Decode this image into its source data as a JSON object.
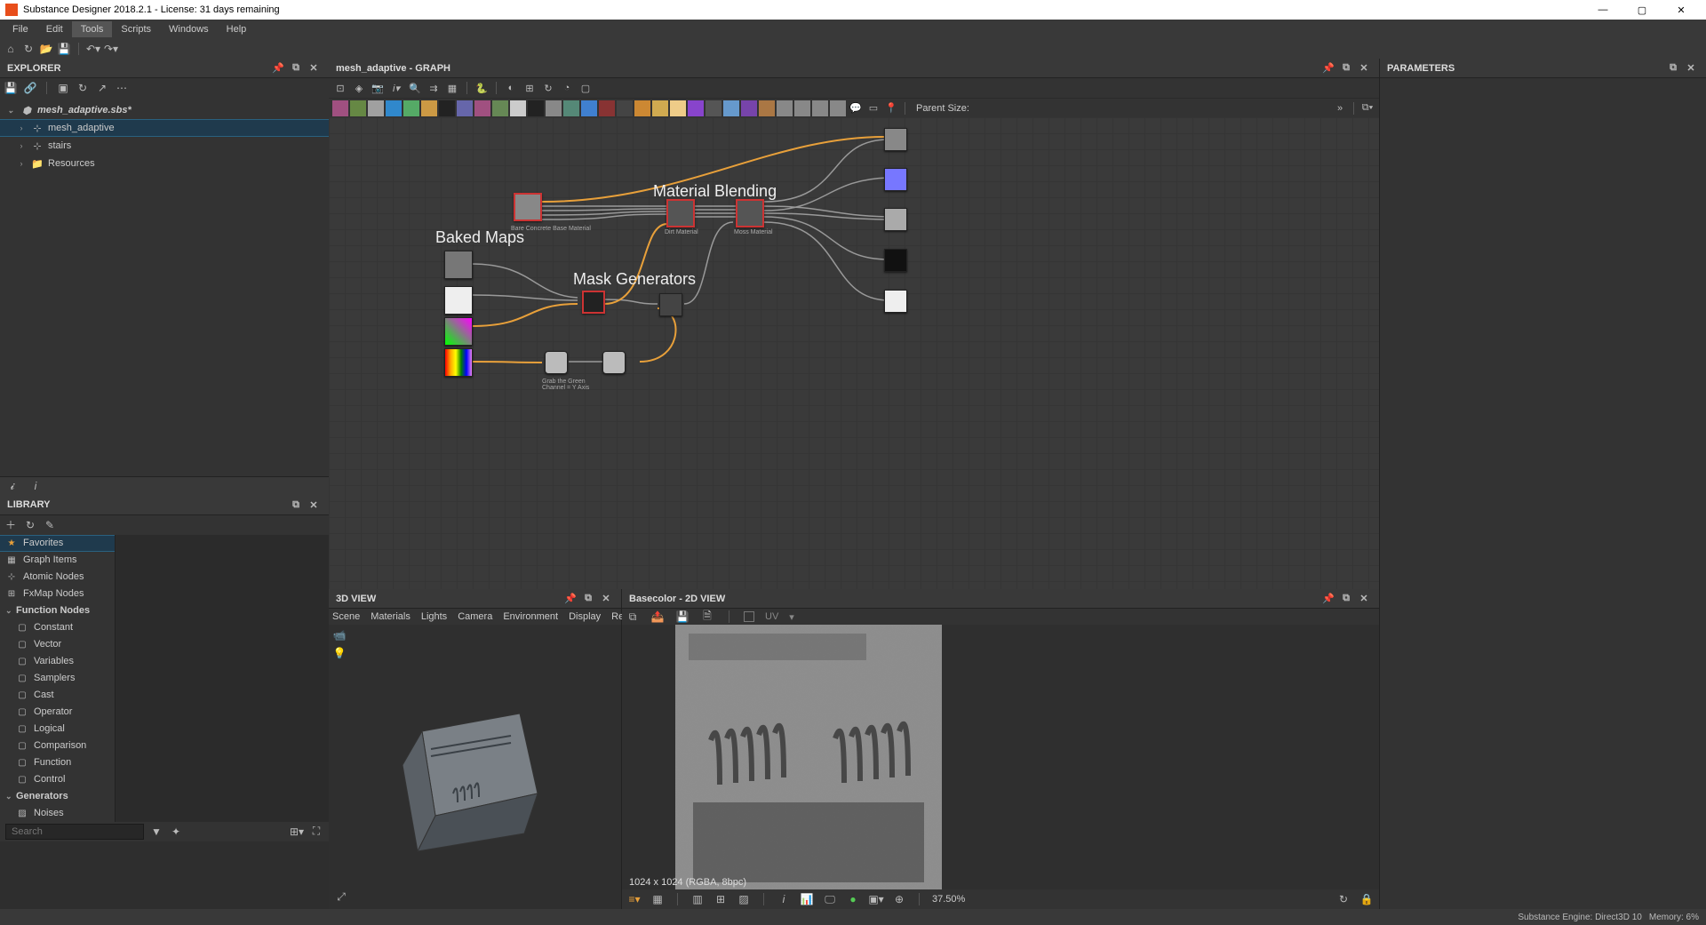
{
  "title": "Substance Designer 2018.2.1 - License: 31 days remaining",
  "menus": [
    "File",
    "Edit",
    "Tools",
    "Scripts",
    "Windows",
    "Help"
  ],
  "menu_hl_index": 2,
  "explorer": {
    "title": "EXPLORER",
    "root": "mesh_adaptive.sbs*",
    "items": [
      {
        "label": "mesh_adaptive",
        "icon": "graph",
        "selected": true
      },
      {
        "label": "stairs",
        "icon": "graph"
      },
      {
        "label": "Resources",
        "icon": "folder"
      }
    ]
  },
  "library": {
    "title": "LIBRARY",
    "search_placeholder": "Search",
    "categories": [
      {
        "label": "Favorites",
        "icon": "star",
        "selected": true
      },
      {
        "label": "Graph Items",
        "icon": "graph"
      },
      {
        "label": "Atomic Nodes",
        "icon": "atomic"
      },
      {
        "label": "FxMap Nodes",
        "icon": "fx"
      }
    ],
    "function_nodes": {
      "label": "Function Nodes",
      "children": [
        "Constant",
        "Vector",
        "Variables",
        "Samplers",
        "Cast",
        "Operator",
        "Logical",
        "Comparison",
        "Function",
        "Control"
      ]
    },
    "generators": {
      "label": "Generators",
      "children": [
        "Noises"
      ]
    }
  },
  "graph": {
    "title": "mesh_adaptive - GRAPH",
    "parent_size_label": "Parent Size:",
    "labels": {
      "baked": "Baked Maps",
      "mask": "Mask Generators",
      "blend": "Material Blending"
    },
    "sublabels": {
      "bare": "Bare Concrete Base Material",
      "dirt": "Dirt Material",
      "moss": "Moss Material",
      "grab": "Grab the Green\nChannel = Y Axis"
    }
  },
  "view3d": {
    "title": "3D VIEW",
    "menus": [
      "Scene",
      "Materials",
      "Lights",
      "Camera",
      "Environment",
      "Display",
      "Renderer"
    ]
  },
  "view2d": {
    "title": "Basecolor - 2D VIEW",
    "uv_label": "UV",
    "info": "1024 x 1024 (RGBA, 8bpc)",
    "zoom": "37.50%"
  },
  "parameters": {
    "title": "PARAMETERS"
  },
  "status": {
    "engine": "Substance Engine: Direct3D 10",
    "memory": "Memory: 6%"
  },
  "swatches": [
    "#a05080",
    "#668844",
    "#a0a0a0",
    "#3088cc",
    "#55aa66",
    "#cc9944",
    "#222",
    "#6666aa",
    "#a05080",
    "#668855",
    "#cccccc",
    "#222222",
    "#888",
    "#558877",
    "#4080d0",
    "#883333",
    "#444",
    "#cc8833",
    "#d0aa50",
    "#eecc88",
    "#8844cc",
    "#555",
    "#6699cc",
    "#7744aa",
    "#aa7744",
    "#888",
    "#888",
    "#888",
    "#888"
  ]
}
